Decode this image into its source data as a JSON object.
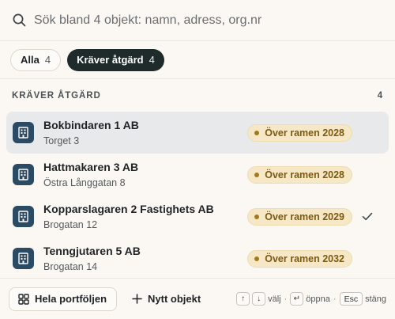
{
  "search": {
    "placeholder": "Sök bland 4 objekt: namn, adress, org.nr",
    "value": ""
  },
  "filters": [
    {
      "label": "Alla",
      "count": "4",
      "selected": false
    },
    {
      "label": "Kräver åtgärd",
      "count": "4",
      "selected": true
    }
  ],
  "section": {
    "title": "KRÄVER ÅTGÄRD",
    "count": "4"
  },
  "items": [
    {
      "name": "Bokbindaren 1 AB",
      "address": "Torget 3",
      "badge": "Över ramen 2028",
      "active": true,
      "checked": false
    },
    {
      "name": "Hattmakaren 3 AB",
      "address": "Östra Långgatan 8",
      "badge": "Över ramen 2028",
      "active": false,
      "checked": false
    },
    {
      "name": "Kopparslagaren 2 Fastighets AB",
      "address": "Brogatan 12",
      "badge": "Över ramen 2029",
      "active": false,
      "checked": true
    },
    {
      "name": "Tenngjutaren 5 AB",
      "address": "Brogatan 14",
      "badge": "Över ramen 2032",
      "active": false,
      "checked": false
    }
  ],
  "footer": {
    "portfolio_label": "Hela portföljen",
    "new_label": "Nytt objekt",
    "hint_up": "↑",
    "hint_down": "↓",
    "hint_select": "välj",
    "hint_enter": "↵",
    "hint_open": "öppna",
    "hint_esc": "Esc",
    "hint_close": "stäng",
    "hint_sep": "·"
  },
  "colors": {
    "background": "#fbf8f3",
    "accent_dark": "#1f2a2a",
    "icon_tile": "#2b4a63",
    "badge_bg": "#f6e8c6",
    "badge_text": "#7a5a14",
    "active_row": "#e7e9ea"
  },
  "icons": {
    "search": "search-icon",
    "building": "building-icon",
    "check": "check-icon",
    "grid": "grid-icon",
    "plus": "plus-icon"
  }
}
